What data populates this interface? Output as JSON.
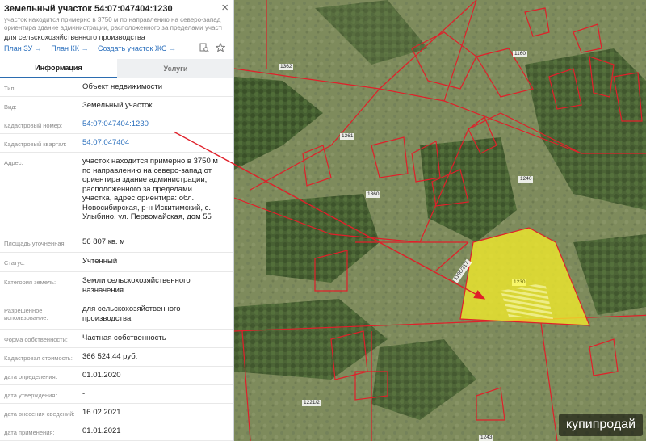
{
  "header": {
    "title": "Земельный участок 54:07:047404:1230",
    "close": "×",
    "description_lines": [
      "участок находится примерно в 3750 м по направлению на северо-запад от",
      "ориентира здание администрации, расположенного за пределами участка, ..."
    ],
    "purpose": "для сельскохозяйственного производства",
    "links": [
      "План ЗУ →",
      "План КК →",
      "Создать участок ЖС →"
    ],
    "icons": [
      "search-doc-icon",
      "star-icon"
    ]
  },
  "tabs": [
    {
      "label": "Информация",
      "active": true
    },
    {
      "label": "Услуги",
      "active": false
    }
  ],
  "rows": [
    {
      "label": "Тип:",
      "value": "Объект недвижимости"
    },
    {
      "label": "Вид:",
      "value": "Земельный участок"
    },
    {
      "label": "Кадастровый номер:",
      "value": "54:07:047404:1230",
      "link": true
    },
    {
      "label": "Кадастровый квартал:",
      "value": "54:07:047404",
      "link": true
    },
    {
      "label": "Адрес:",
      "value": "участок находится примерно в 3750 м по направлению на северо-запад от ориентира здание администрации, расположенного за пределами участка, адрес ориентира: обл. Новосибирская, р-н Искитимский, с. Улыбино, ул. Первомайская, дом 55"
    },
    {
      "label": "Площадь уточненная:",
      "value": "56 807 кв. м"
    },
    {
      "label": "Статус:",
      "value": "Учтенный"
    },
    {
      "label": "Категория земель:",
      "value": "Земли сельскохозяйственного назначения"
    },
    {
      "label": "Разрешенное использование:",
      "value": "для сельскохозяйственного производства"
    },
    {
      "label": "Форма собственности:",
      "value": "Частная собственность"
    },
    {
      "label": "Кадастровая стоимость:",
      "value": "366 524,44 руб."
    },
    {
      "label": "дата определения:",
      "value": "01.01.2020"
    },
    {
      "label": "дата утверждения:",
      "value": "-"
    },
    {
      "label": "дата внесения сведений:",
      "value": "16.02.2021"
    },
    {
      "label": "дата применения:",
      "value": "01.01.2021"
    }
  ],
  "map": {
    "parcel_labels": [
      "1362",
      "1160",
      "1361",
      "1360",
      "1240",
      "1230",
      "1196/217",
      "1221/2",
      "1243"
    ],
    "selected_parcel": "1230",
    "boundary_color": "#e0202a",
    "selection_color": "#f2ec2a",
    "arrow_color": "#e0202a"
  },
  "watermark": "купипродай"
}
